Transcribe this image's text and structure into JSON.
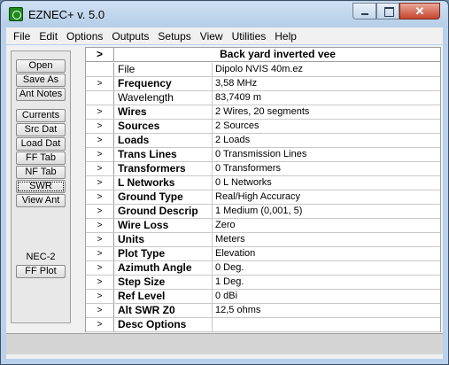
{
  "window": {
    "title": "EZNEC+  v. 5.0"
  },
  "menu": [
    "File",
    "Edit",
    "Options",
    "Outputs",
    "Setups",
    "View",
    "Utilities",
    "Help"
  ],
  "left_buttons_top": [
    "Open",
    "Save As",
    "Ant Notes"
  ],
  "left_buttons_mid": [
    "Currents",
    "Src Dat",
    "Load Dat",
    "FF Tab",
    "NF Tab",
    "SWR",
    "View Ant"
  ],
  "nec_label": "NEC-2",
  "ff_plot": "FF Plot",
  "grid": {
    "header_arrow": ">",
    "title": "Back yard inverted vee",
    "row_arrow": ">",
    "rows": [
      {
        "label": "File",
        "value": "Dipolo NVIS 40m.ez",
        "arrow": false,
        "bold": false
      },
      {
        "label": "Frequency",
        "value": "3,58 MHz",
        "arrow": true,
        "bold": true
      },
      {
        "label": "Wavelength",
        "value": "83,7409 m",
        "arrow": false,
        "bold": false
      },
      {
        "label": "Wires",
        "value": "2 Wires, 20 segments",
        "arrow": true,
        "bold": true
      },
      {
        "label": "Sources",
        "value": "2 Sources",
        "arrow": true,
        "bold": true
      },
      {
        "label": "Loads",
        "value": "2 Loads",
        "arrow": true,
        "bold": true
      },
      {
        "label": "Trans Lines",
        "value": "0 Transmission Lines",
        "arrow": true,
        "bold": true
      },
      {
        "label": "Transformers",
        "value": "0 Transformers",
        "arrow": true,
        "bold": true
      },
      {
        "label": "L Networks",
        "value": "0 L Networks",
        "arrow": true,
        "bold": true
      },
      {
        "label": "Ground Type",
        "value": "Real/High Accuracy",
        "arrow": true,
        "bold": true
      },
      {
        "label": "Ground Descrip",
        "value": "1 Medium (0,001, 5)",
        "arrow": true,
        "bold": true
      },
      {
        "label": "Wire Loss",
        "value": "Zero",
        "arrow": true,
        "bold": true
      },
      {
        "label": "Units",
        "value": "Meters",
        "arrow": true,
        "bold": true
      },
      {
        "label": "Plot Type",
        "value": "Elevation",
        "arrow": true,
        "bold": true
      },
      {
        "label": "Azimuth Angle",
        "value": "0 Deg.",
        "arrow": true,
        "bold": true
      },
      {
        "label": "Step Size",
        "value": "1 Deg.",
        "arrow": true,
        "bold": true
      },
      {
        "label": "Ref Level",
        "value": "0 dBi",
        "arrow": true,
        "bold": true
      },
      {
        "label": "Alt SWR Z0",
        "value": "12,5 ohms",
        "arrow": true,
        "bold": true
      },
      {
        "label": "Desc Options",
        "value": "",
        "arrow": true,
        "bold": true
      }
    ]
  },
  "icons": {
    "app": "eznec-app-icon",
    "minimize": "minimize-icon",
    "maximize": "maximize-icon",
    "close": "close-icon"
  },
  "close_glyph": "✕"
}
